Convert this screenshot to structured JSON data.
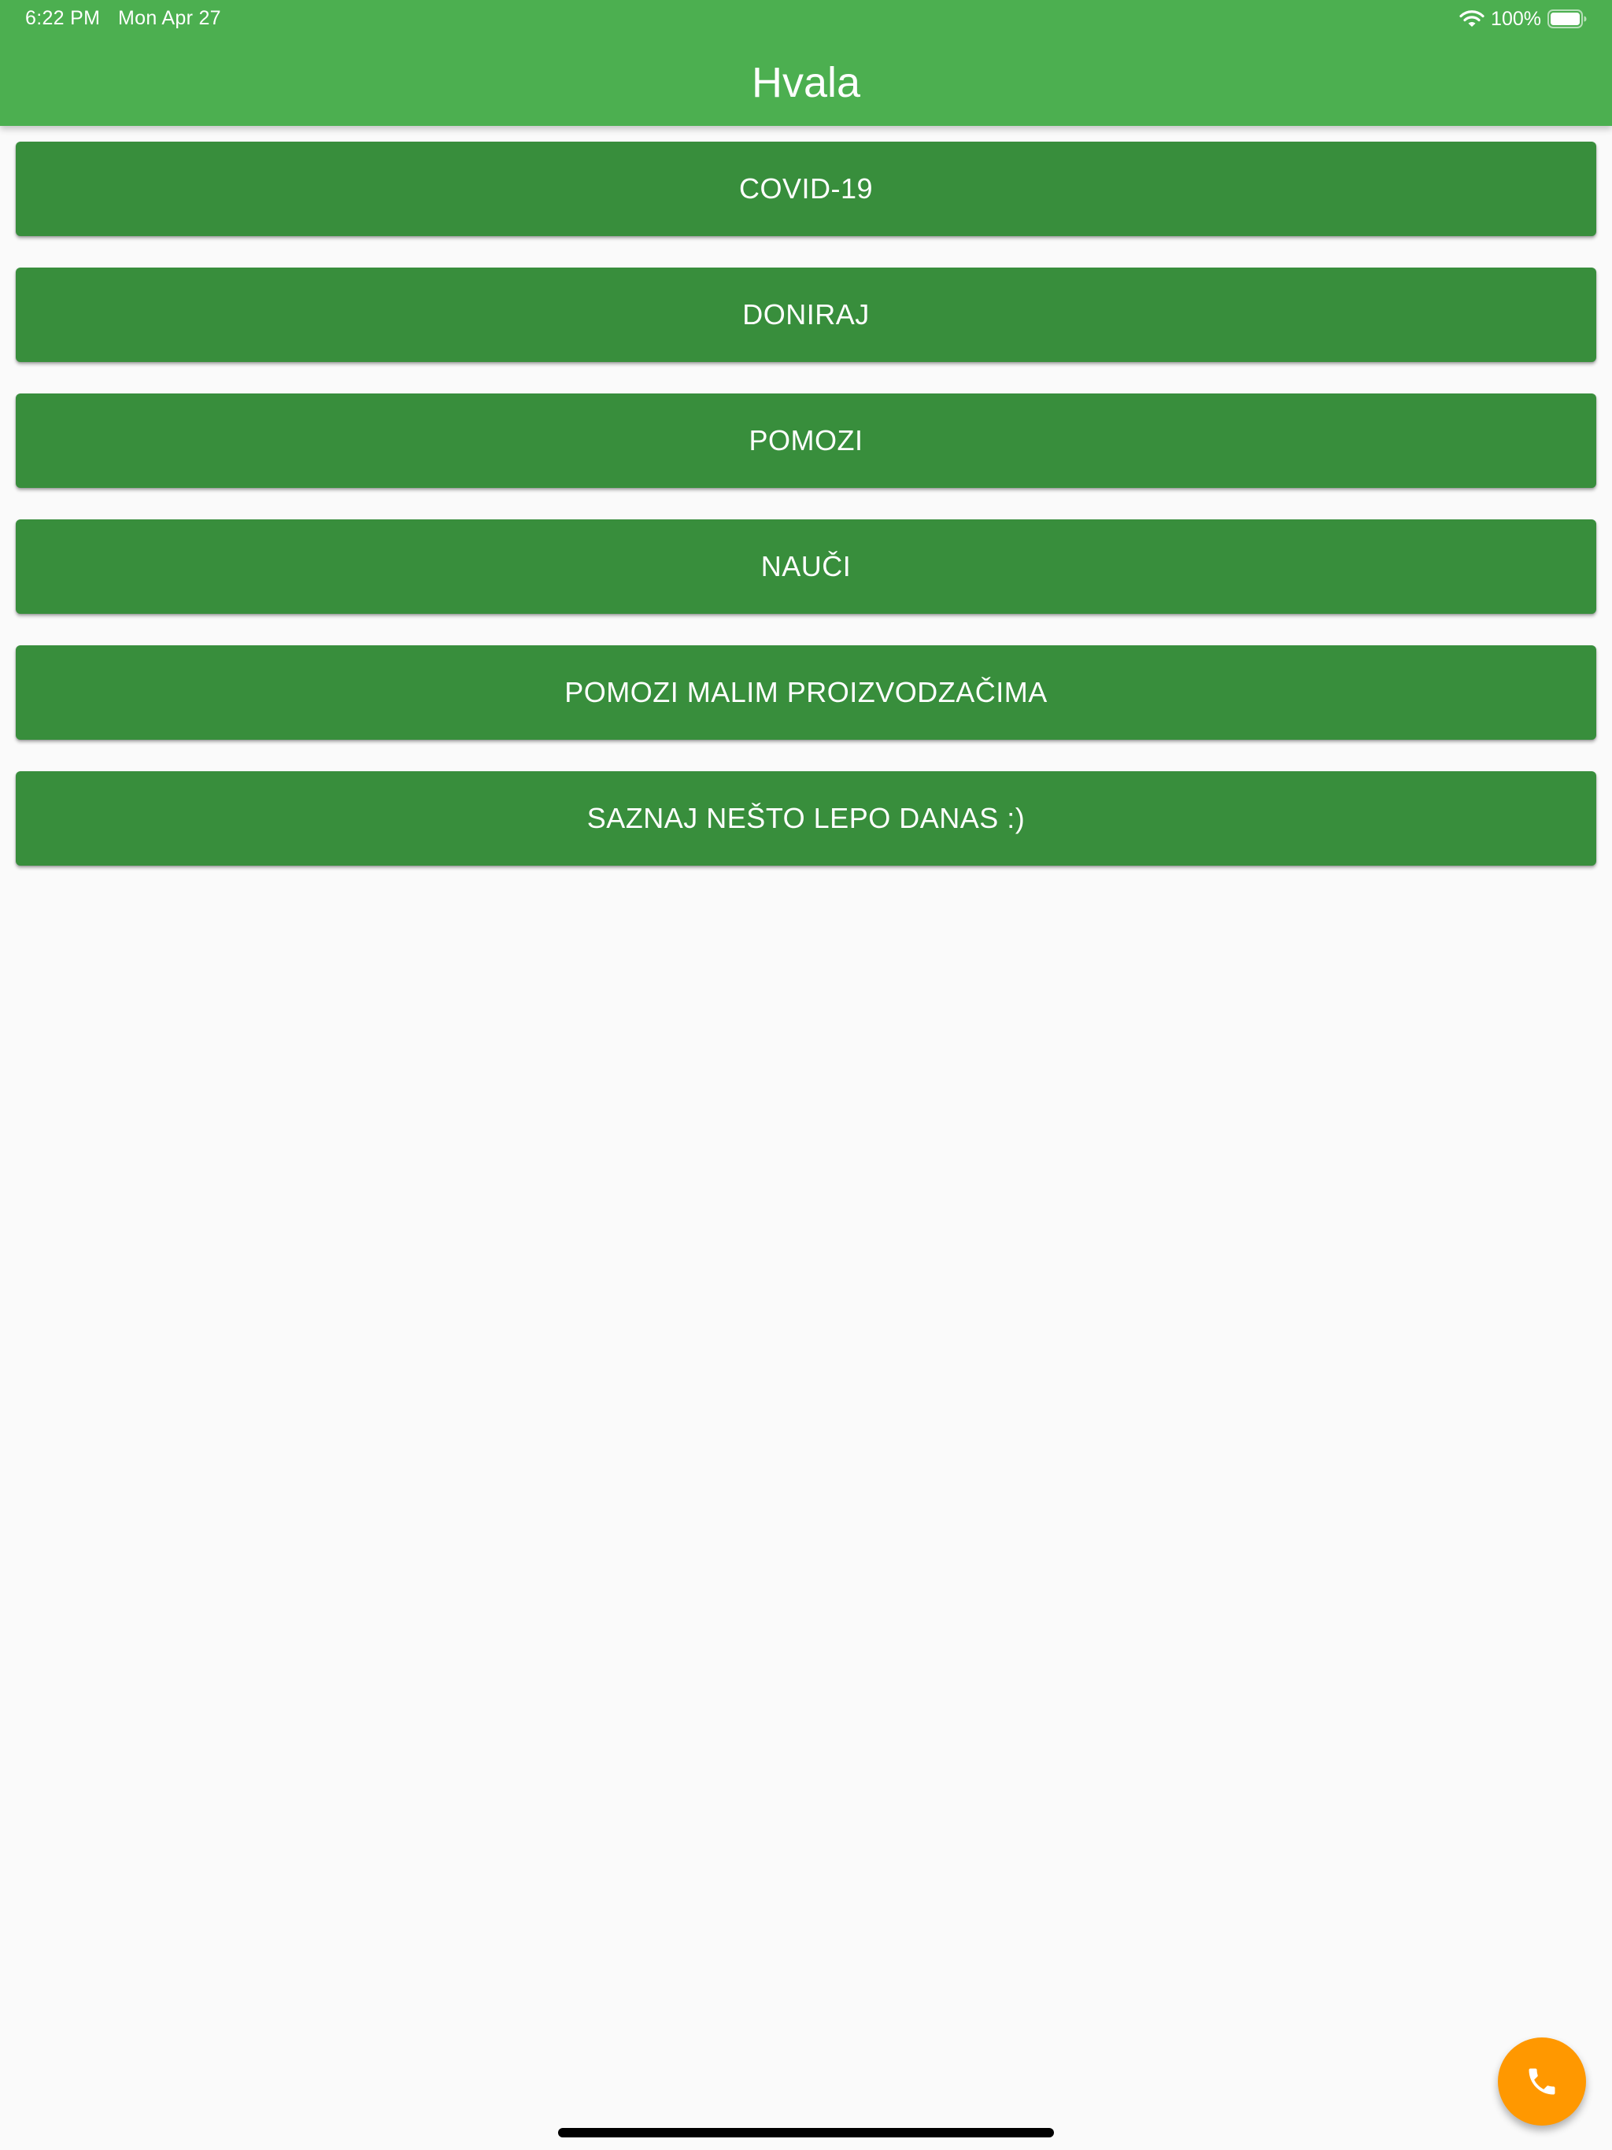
{
  "status_bar": {
    "time": "6:22 PM",
    "date": "Mon Apr 27",
    "battery_percent": "100%",
    "battery_level": 1.0,
    "wifi_icon": "wifi-icon",
    "battery_icon": "battery-full-icon"
  },
  "app_bar": {
    "title": "Hvala",
    "color": "#4CAF50"
  },
  "menu": {
    "button_color": "#388E3C",
    "items": [
      {
        "label": "COVID-19"
      },
      {
        "label": "DONIRAJ"
      },
      {
        "label": "POMOZI"
      },
      {
        "label": "NAUČI"
      },
      {
        "label": "POMOZI MALIM PROIZVODZAČIMA"
      },
      {
        "label": "SAZNAJ NEŠTO LEPO DANAS :)"
      }
    ]
  },
  "fab": {
    "icon": "phone-icon",
    "color": "#FF9800"
  }
}
